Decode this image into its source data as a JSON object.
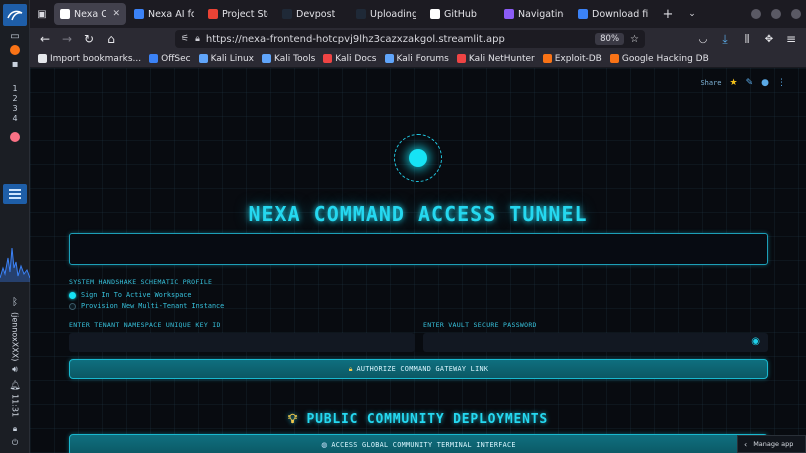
{
  "desktop": {
    "workspaces": [
      "1",
      "2",
      "3",
      "4"
    ],
    "username": "(jennoxXXX)",
    "clock": "11:31"
  },
  "browser": {
    "tabs": [
      {
        "label": "Nexa Core",
        "active": true,
        "color": "#ffffff",
        "icon": "app-icon"
      },
      {
        "label": "Nexa AI for R",
        "active": false,
        "color": "#3b82f6",
        "icon": "globe-icon"
      },
      {
        "label": "Project Story",
        "active": false,
        "color": "#ea4335",
        "icon": "gmail-icon"
      },
      {
        "label": "Devpost",
        "active": false,
        "color": "#1f2937",
        "icon": "devpost-icon"
      },
      {
        "label": "Uploading a",
        "active": false,
        "color": "#1f2937",
        "icon": "devpost-icon"
      },
      {
        "label": "GitHub",
        "active": false,
        "color": "#ffffff",
        "icon": "github-icon"
      },
      {
        "label": "Navigating a",
        "active": false,
        "color": "#8b5cf6",
        "icon": "sparkle-icon"
      },
      {
        "label": "Download file",
        "active": false,
        "color": "#3b82f6",
        "icon": "doc-icon"
      }
    ],
    "new_tab_label": "+",
    "url": "https://nexa-frontend-hotcpvj9lhz3cazxzakgol.streamlit.app",
    "zoom": "80%",
    "bookmarks": [
      {
        "label": "Import bookmarks...",
        "color": "#e5e7eb"
      },
      {
        "label": "OffSec",
        "color": "#3b82f6"
      },
      {
        "label": "Kali Linux",
        "color": "#60a5fa"
      },
      {
        "label": "Kali Tools",
        "color": "#60a5fa"
      },
      {
        "label": "Kali Docs",
        "color": "#ef4444"
      },
      {
        "label": "Kali Forums",
        "color": "#60a5fa"
      },
      {
        "label": "Kali NetHunter",
        "color": "#ef4444"
      },
      {
        "label": "Exploit-DB",
        "color": "#f97316"
      },
      {
        "label": "Google Hacking DB",
        "color": "#f97316"
      }
    ]
  },
  "app": {
    "share_label": "Share",
    "title": "NEXA COMMAND ACCESS TUNNEL",
    "profile_label": "SYSTEM HANDSHAKE SCHEMATIC PROFILE",
    "radio_options": [
      {
        "label": "Sign In To Active Workspace",
        "selected": true
      },
      {
        "label": "Provision New Multi-Tenant Instance",
        "selected": false
      }
    ],
    "key_label": "ENTER TENANT NAMESPACE UNIQUE KEY ID",
    "password_label": "ENTER VAULT SECURE PASSWORD",
    "authorize_button": "AUTHORIZE COMMAND GATEWAY LINK",
    "section_title": "PUBLIC COMMUNITY DEPLOYMENTS",
    "community_button": "ACCESS GLOBAL COMMUNITY TERMINAL INTERFACE",
    "manage_app": "Manage app",
    "accent_color": "#25d8f0"
  }
}
